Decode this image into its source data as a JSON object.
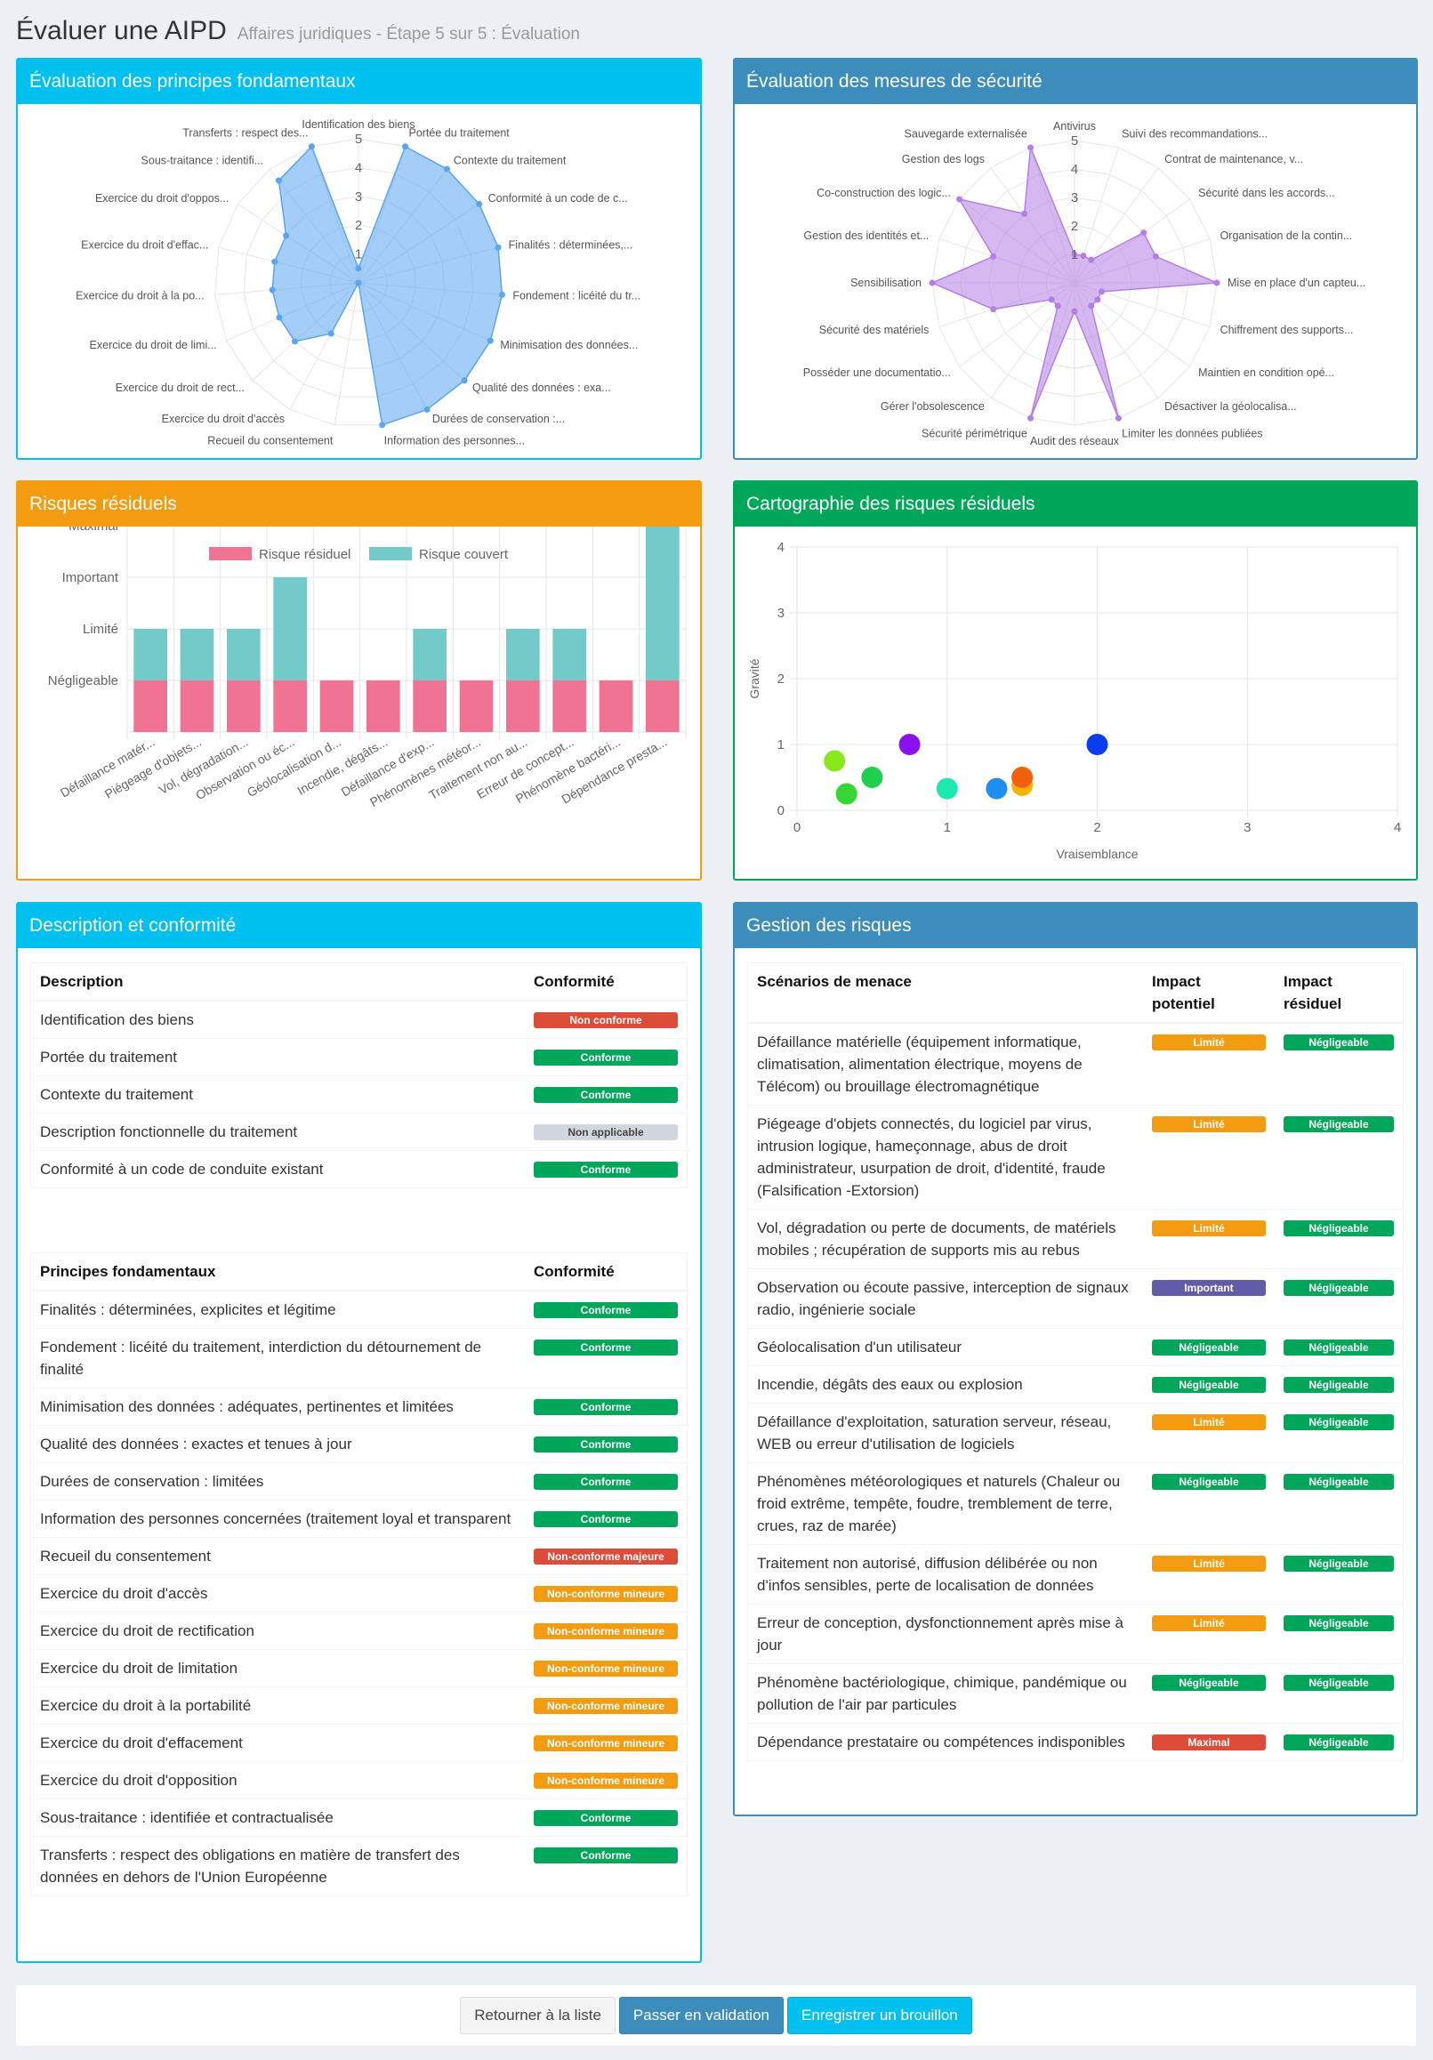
{
  "header": {
    "title": "Évaluer une AIPD",
    "subtitle": "Affaires juridiques - Étape 5 sur 5 : Évaluation"
  },
  "colors": {
    "aqua": "#00c0ef",
    "blue": "#3c8dbc",
    "orange": "#f39c12",
    "green": "#00a65a",
    "red": "#dd4b39",
    "purple": "#605ca8"
  },
  "principes_chart": {
    "title": "Évaluation des principes fondamentaux",
    "chart_data": {
      "type": "radar",
      "rmax": 5,
      "ticks": [
        "1",
        "2",
        "3",
        "4",
        "5"
      ],
      "color": "#5aa5f0",
      "labels": [
        "Identification des biens",
        "Portée du traitement",
        "Contexte du traitement",
        "Conformité à un code de c...",
        "Finalités : déterminées,...",
        "Fondement : licéité du tr...",
        "Minimisation des données...",
        "Qualité des données : exa...",
        "Durées de conservation :...",
        "Information des personnes...",
        "Recueil du consentement",
        "Exercice du droit d'accès",
        "Exercice du droit de rect...",
        "Exercice du droit de limi...",
        "Exercice du droit à la po...",
        "Exercice du droit d'effac...",
        "Exercice du droit d'oppos...",
        "Sous-traitance : identifi...",
        "Transferts : respect des..."
      ],
      "values": [
        0.5,
        5,
        5,
        5,
        5,
        5,
        5,
        5,
        5,
        5,
        0,
        2,
        3,
        3,
        3,
        3,
        3,
        4.5,
        5
      ]
    }
  },
  "securite_chart": {
    "title": "Évaluation des mesures de sécurité",
    "chart_data": {
      "type": "radar",
      "rmax": 5,
      "ticks": [
        "1",
        "2",
        "3",
        "4",
        "5"
      ],
      "color": "#b57ee6",
      "labels": [
        "Antivirus",
        "Suivi des recommandations...",
        "Contrat de maintenance, v...",
        "Sécurité dans les accords...",
        "Organisation de la contin...",
        "Mise en place d'un capteu...",
        "Chiffrement des supports...",
        "Maintien en condition opé...",
        "Désactiver la géolocalisa...",
        "Limiter les données publiées",
        "Audit des réseaux",
        "Sécurité périmétrique",
        "Gérer l'obsolescence",
        "Posséder une documentatio...",
        "Sécurité des matériels",
        "Sensibilisation",
        "Gestion des identités et...",
        "Co-construction des logic...",
        "Gestion des logs",
        "Sauvegarde externalisée"
      ],
      "values": [
        1,
        1,
        1,
        3,
        3,
        5,
        1,
        1,
        1,
        5,
        1,
        5,
        1,
        1,
        3,
        5,
        3,
        5,
        3,
        5
      ]
    }
  },
  "residuel_chart": {
    "title": "Risques résiduels",
    "chart_data": {
      "type": "bar",
      "stacked": true,
      "categories": [
        "Défaillance matér...",
        "Piégeage d'objets...",
        "Vol, dégradation...",
        "Observation ou éc...",
        "Géolocalisation d...",
        "Incendie, dégâts...",
        "Défaillance d'exp...",
        "Phénomènes météor...",
        "Traitement non au...",
        "Erreur de concept...",
        "Phénomène bactéri...",
        "Dépendance presta..."
      ],
      "y_levels": [
        "Négligeable",
        "Limité",
        "Important",
        "Maximal"
      ],
      "series": [
        {
          "name": "Risque résiduel",
          "color": "#f07393",
          "values": [
            1,
            1,
            1,
            1,
            1,
            1,
            1,
            1,
            1,
            1,
            1,
            1
          ]
        },
        {
          "name": "Risque couvert",
          "color": "#72cbc9",
          "values": [
            1,
            1,
            1,
            2,
            0,
            0,
            1,
            0,
            1,
            1,
            0,
            3
          ]
        }
      ]
    }
  },
  "carto_chart": {
    "title": "Cartographie des risques résiduels",
    "chart_data": {
      "type": "scatter",
      "xlabel": "Vraisemblance",
      "ylabel": "Gravité",
      "xlim": [
        0,
        4
      ],
      "ylim": [
        0,
        4
      ],
      "xticks": [
        "0",
        "1",
        "2",
        "3",
        "4"
      ],
      "yticks": [
        "0",
        "1",
        "2",
        "3",
        "4"
      ],
      "points": [
        {
          "x": 0.25,
          "y": 0.75,
          "color": "#88e81c"
        },
        {
          "x": 0.33,
          "y": 0.25,
          "color": "#37d637"
        },
        {
          "x": 0.5,
          "y": 0.5,
          "color": "#1fd04e"
        },
        {
          "x": 0.75,
          "y": 1,
          "color": "#8a12f0"
        },
        {
          "x": 1,
          "y": 0.33,
          "color": "#1ce8b0"
        },
        {
          "x": 1.33,
          "y": 0.33,
          "color": "#1e8ef0"
        },
        {
          "x": 1.5,
          "y": 0.38,
          "color": "#f5b400"
        },
        {
          "x": 1.5,
          "y": 0.5,
          "color": "#f0600e"
        },
        {
          "x": 2,
          "y": 1,
          "color": "#0a3cf0"
        }
      ]
    }
  },
  "description": {
    "title": "Description et conformité",
    "table1": {
      "col1": "Description",
      "col2": "Conformité",
      "rows": [
        {
          "label": "Identification des biens",
          "status": "Non conforme",
          "color": "red"
        },
        {
          "label": "Portée du traitement",
          "status": "Conforme",
          "color": "green"
        },
        {
          "label": "Contexte du traitement",
          "status": "Conforme",
          "color": "green"
        },
        {
          "label": "Description fonctionnelle du traitement",
          "status": "Non applicable",
          "color": "gray"
        },
        {
          "label": "Conformité à un code de conduite existant",
          "status": "Conforme",
          "color": "green"
        }
      ]
    },
    "table2": {
      "col1": "Principes fondamentaux",
      "col2": "Conformité",
      "rows": [
        {
          "label": "Finalités : déterminées, explicites et légitime",
          "status": "Conforme",
          "color": "green"
        },
        {
          "label": "Fondement : licéité du traitement, interdiction du détournement de finalité",
          "status": "Conforme",
          "color": "green"
        },
        {
          "label": "Minimisation des données : adéquates, pertinentes et limitées",
          "status": "Conforme",
          "color": "green"
        },
        {
          "label": "Qualité des données : exactes et tenues à jour",
          "status": "Conforme",
          "color": "green"
        },
        {
          "label": "Durées de conservation : limitées",
          "status": "Conforme",
          "color": "green"
        },
        {
          "label": "Information des personnes concernées (traitement loyal et transparent",
          "status": "Conforme",
          "color": "green"
        },
        {
          "label": "Recueil du consentement",
          "status": "Non-conforme majeure",
          "color": "red"
        },
        {
          "label": "Exercice du droit d'accès",
          "status": "Non-conforme mineure",
          "color": "orange"
        },
        {
          "label": "Exercice du droit de rectification",
          "status": "Non-conforme mineure",
          "color": "orange"
        },
        {
          "label": "Exercice du droit de limitation",
          "status": "Non-conforme mineure",
          "color": "orange"
        },
        {
          "label": "Exercice du droit à la portabilité",
          "status": "Non-conforme mineure",
          "color": "orange"
        },
        {
          "label": "Exercice du droit d'effacement",
          "status": "Non-conforme mineure",
          "color": "orange"
        },
        {
          "label": "Exercice du droit d'opposition",
          "status": "Non-conforme mineure",
          "color": "orange"
        },
        {
          "label": "Sous-traitance : identifiée et contractualisée",
          "status": "Conforme",
          "color": "green"
        },
        {
          "label": "Transferts : respect des obligations en matière de transfert des données en dehors de l'Union Européenne",
          "status": "Conforme",
          "color": "green"
        }
      ]
    }
  },
  "gestion": {
    "title": "Gestion des risques",
    "col1": "Scénarios de menace",
    "col2": "Impact potentiel",
    "col3": "Impact résiduel",
    "rows": [
      {
        "label": "Défaillance matérielle (équipement informatique, climatisation, alimentation électrique, moyens de Télécom) ou brouillage électromagnétique",
        "impact": "Limité",
        "impact_color": "orange",
        "residuel": "Négligeable"
      },
      {
        "label": "Piégeage d'objets connectés, du logiciel par virus, intrusion logique, hameçonnage, abus de droit administrateur, usurpation de droit, d'identité, fraude (Falsification -Extorsion)",
        "impact": "Limité",
        "impact_color": "orange",
        "residuel": "Négligeable"
      },
      {
        "label": "Vol, dégradation ou perte de documents, de matériels mobiles ; récupération de supports mis au rebus",
        "impact": "Limité",
        "impact_color": "orange",
        "residuel": "Négligeable"
      },
      {
        "label": "Observation ou écoute passive, interception de signaux radio, ingénierie sociale",
        "impact": "Important",
        "impact_color": "purple",
        "residuel": "Négligeable"
      },
      {
        "label": "Géolocalisation d'un utilisateur",
        "impact": "Négligeable",
        "impact_color": "green",
        "residuel": "Négligeable"
      },
      {
        "label": "Incendie, dégâts des eaux ou explosion",
        "impact": "Négligeable",
        "impact_color": "green",
        "residuel": "Négligeable"
      },
      {
        "label": "Défaillance d'exploitation, saturation serveur, réseau, WEB ou erreur d'utilisation de logiciels",
        "impact": "Limité",
        "impact_color": "orange",
        "residuel": "Négligeable"
      },
      {
        "label": "Phénomènes météorologiques et naturels (Chaleur ou froid extrême, tempête, foudre, tremblement de terre, crues, raz de marée)",
        "impact": "Négligeable",
        "impact_color": "green",
        "residuel": "Négligeable"
      },
      {
        "label": "Traitement non autorisé, diffusion délibérée ou non d'infos sensibles, perte de localisation de données",
        "impact": "Limité",
        "impact_color": "orange",
        "residuel": "Négligeable"
      },
      {
        "label": "Erreur de conception, dysfonctionnement après mise à jour",
        "impact": "Limité",
        "impact_color": "orange",
        "residuel": "Négligeable"
      },
      {
        "label": "Phénomène bactériologique, chimique, pandémique ou pollution de l'air par particules",
        "impact": "Négligeable",
        "impact_color": "green",
        "residuel": "Négligeable"
      },
      {
        "label": "Dépendance prestataire ou compétences indisponibles",
        "impact": "Maximal",
        "impact_color": "red",
        "residuel": "Négligeable"
      }
    ]
  },
  "footer": {
    "back": "Retourner à la liste",
    "validate": "Passer en validation",
    "draft": "Enregistrer un brouillon"
  }
}
